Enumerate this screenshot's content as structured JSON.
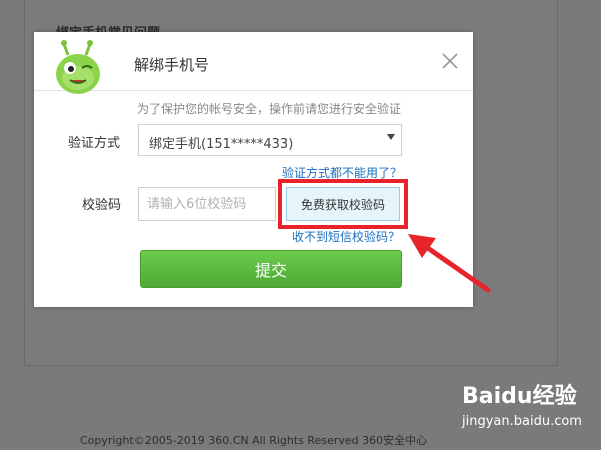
{
  "background": {
    "heading": "绑定手机常见问题",
    "copyright": "Copyright©2005-2019 360.CN All Rights Reserved 360安全中心"
  },
  "dialog": {
    "title": "解绑手机号",
    "hint": "为了保护您的帐号安全，操作前请您进行安全验证",
    "verify_label": "验证方式",
    "verify_selected": "绑定手机(151*****433)",
    "verify_unavailable_link": "验证方式都不能用了？",
    "code_label": "校验码",
    "code_placeholder": "请输入6位校验码",
    "get_code_button": "免费获取校验码",
    "no_sms_link": "收不到短信校验码？",
    "submit_button": "提交"
  },
  "watermark": {
    "logo": "Baidu经验",
    "url": "jingyan.baidu.com"
  },
  "colors": {
    "submit_green": "#5bb83f",
    "link_blue": "#1a6fc0",
    "highlight_red": "#e8242b",
    "overlay_gray": "#7a7a7a"
  }
}
